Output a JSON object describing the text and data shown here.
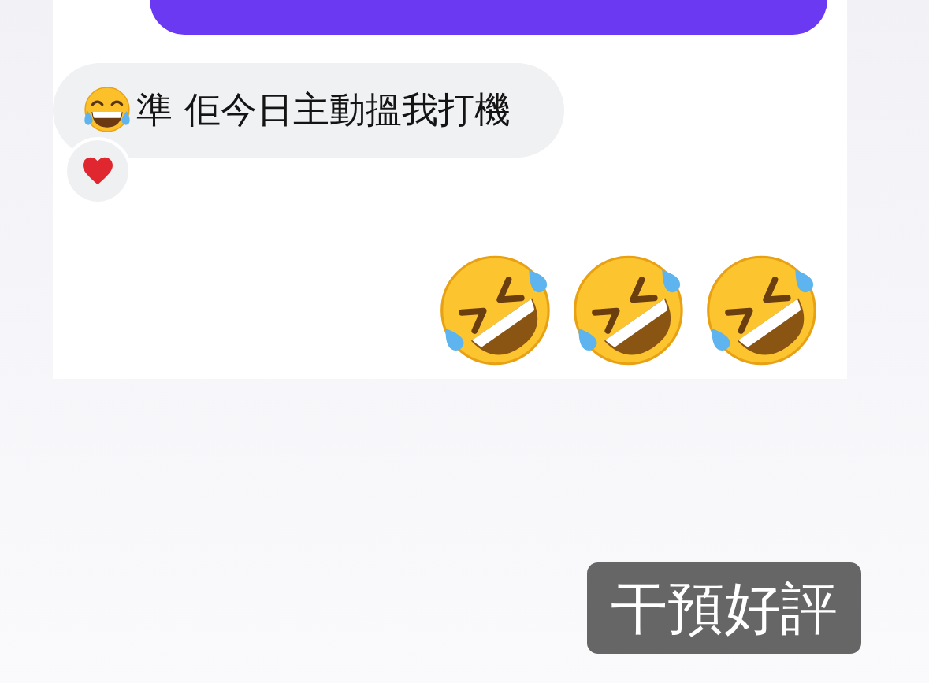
{
  "chat": {
    "messages": [
      {
        "kind": "outgoing"
      },
      {
        "kind": "incoming",
        "text": "準 佢今日主動搵我打機",
        "reaction": true
      },
      {
        "kind": "emoji"
      }
    ]
  },
  "caption": {
    "text": "干預好評"
  }
}
